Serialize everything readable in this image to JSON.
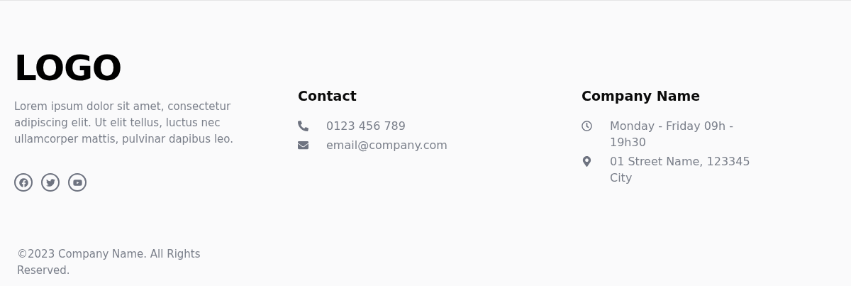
{
  "logo": "LOGO",
  "description": "Lorem ipsum dolor sit amet, consectetur adipiscing elit. Ut elit tellus, luctus nec ullamcorper mattis, pulvinar dapibus leo.",
  "socials": [
    {
      "kind": "facebook"
    },
    {
      "kind": "twitter"
    },
    {
      "kind": "youtube"
    }
  ],
  "contact": {
    "title": "Contact",
    "items": [
      {
        "kind": "phone",
        "text": "0123 456 789"
      },
      {
        "kind": "email",
        "text": "email@company.com"
      }
    ]
  },
  "company": {
    "title": "Company Name",
    "items": [
      {
        "kind": "hours",
        "text": "Monday - Friday 09h - 19h30"
      },
      {
        "kind": "address",
        "text": "01 Street Name, 123345 City"
      }
    ]
  },
  "copyright": "©2023 Company Name. All Rights Reserved."
}
